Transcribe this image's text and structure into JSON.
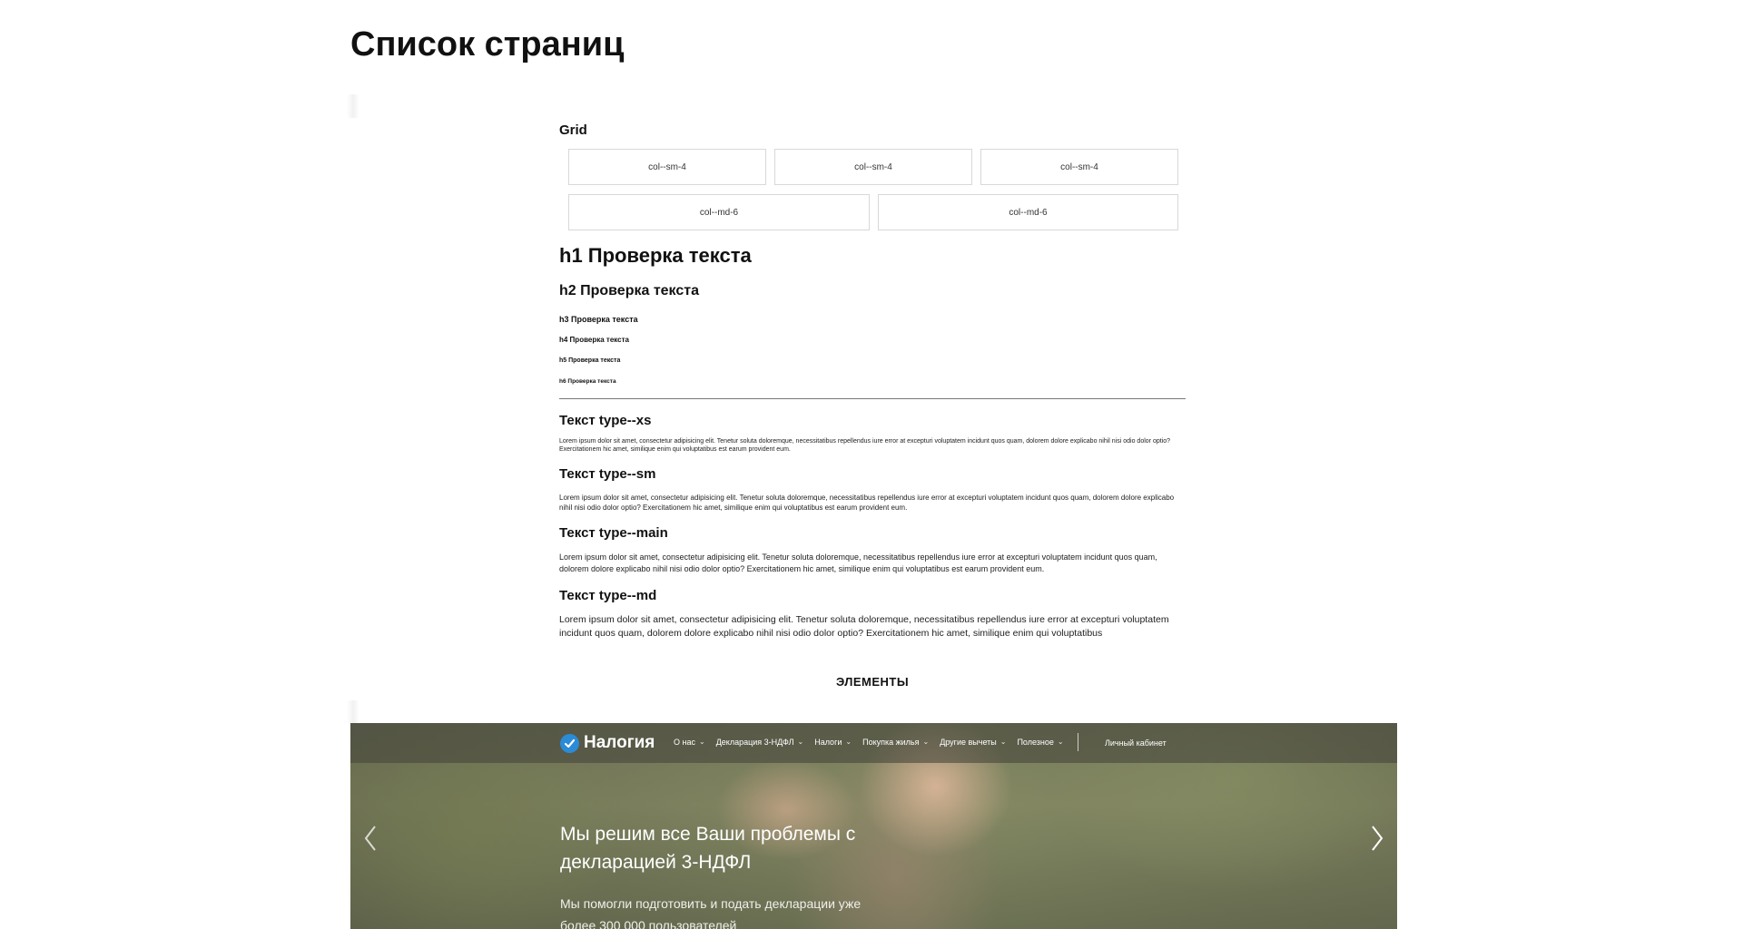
{
  "page": {
    "title": "Список страниц"
  },
  "grid_section": {
    "label": "Grid",
    "row1": [
      "col--sm-4",
      "col--sm-4",
      "col--sm-4"
    ],
    "row2": [
      "col--md-6",
      "col--md-6"
    ]
  },
  "headings": {
    "h1": "h1 Проверка текста",
    "h2": "h2 Проверка текста",
    "h3": "h3 Проверка текста",
    "h4": "h4 Проверка текста",
    "h5": "h5 Проверка текста",
    "h6": "h6 Проверка текста"
  },
  "text_types": {
    "xs": {
      "title": "Текст type--xs",
      "body": "Lorem ipsum dolor sit amet, consectetur adipisicing elit. Tenetur soluta doloremque, necessitatibus repellendus iure error at excepturi voluptatem incidunt quos quam, dolorem dolore explicabo nihil nisi odio dolor optio? Exercitationem hic amet, similique enim qui voluptatibus est earum provident eum."
    },
    "sm": {
      "title": "Текст type--sm",
      "body": "Lorem ipsum dolor sit amet, consectetur adipisicing elit. Tenetur soluta doloremque, necessitatibus repellendus iure error at excepturi voluptatem incidunt quos quam, dolorem dolore explicabo nihil nisi odio dolor optio? Exercitationem hic amet, similique enim qui voluptatibus est earum provident eum."
    },
    "main": {
      "title": "Текст type--main",
      "body": "Lorem ipsum dolor sit amet, consectetur adipisicing elit. Tenetur soluta doloremque, necessitatibus repellendus iure error at excepturi voluptatem incidunt quos quam, dolorem dolore explicabo nihil nisi odio dolor optio? Exercitationem hic amet, similique enim qui voluptatibus est earum provident eum."
    },
    "md": {
      "title": "Текст type--md",
      "body": "Lorem ipsum dolor sit amet, consectetur adipisicing elit. Tenetur soluta doloremque, necessitatibus repellendus iure error at excepturi voluptatem incidunt quos quam, dolorem dolore explicabo nihil nisi odio dolor optio? Exercitationem hic amet, similique enim qui voluptatibus"
    }
  },
  "elements_heading": "ЭЛЕМЕНТЫ",
  "hero": {
    "logo_text": "Налогия",
    "logo_icon": "check-circle-icon",
    "nav": [
      {
        "label": "О нас"
      },
      {
        "label": "Декларация 3-НДФЛ"
      },
      {
        "label": "Налоги"
      },
      {
        "label": "Покупка жилья"
      },
      {
        "label": "Другие вычеты"
      },
      {
        "label": "Полезное"
      }
    ],
    "cabinet": "Личный кабинет",
    "title": "Мы решим все Ваши проблемы с декларацией 3-НДФЛ",
    "subtitle": "Мы помогли подготовить и подать декларации уже более 300 000 пользователей",
    "accent_color": "#2b8bd6"
  }
}
